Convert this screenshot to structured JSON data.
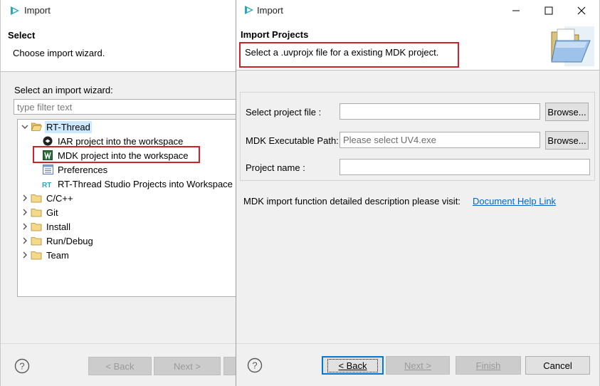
{
  "left_dialog": {
    "title": "Import",
    "header": {
      "title": "Select",
      "description": "Choose import wizard."
    },
    "wizard_label": "Select an import wizard:",
    "filter": {
      "placeholder": "type filter text",
      "value": ""
    },
    "tree": [
      {
        "label": "RT-Thread",
        "icon": "folder-open-icon",
        "expanded": true
      },
      {
        "label": "IAR project into the workspace",
        "icon": "iar-icon"
      },
      {
        "label": "MDK project into the workspace",
        "icon": "mdk-icon",
        "highlighted": true
      },
      {
        "label": "Preferences",
        "icon": "preferences-icon"
      },
      {
        "label": "RT-Thread Studio Projects into Workspace",
        "icon": "rt-thread-icon"
      },
      {
        "label": "C/C++",
        "icon": "folder-icon"
      },
      {
        "label": "Git",
        "icon": "folder-icon"
      },
      {
        "label": "Install",
        "icon": "folder-icon"
      },
      {
        "label": "Run/Debug",
        "icon": "folder-icon"
      },
      {
        "label": "Team",
        "icon": "folder-icon"
      }
    ],
    "buttons": {
      "back": "< Back",
      "next": "Next >"
    }
  },
  "right_dialog": {
    "title": "Import",
    "header": {
      "title": "Import Projects",
      "description": "Select a .uvprojx file for a existing MDK project."
    },
    "form": {
      "project_file": {
        "label": "Select project file :",
        "value": "",
        "browse": "Browse..."
      },
      "mdk_path": {
        "label": "MDK Executable Path:",
        "placeholder": "Please select UV4.exe",
        "value": "",
        "browse": "Browse..."
      },
      "project_name": {
        "label": "Project name :",
        "value": ""
      }
    },
    "description": "MDK import function detailed description please visit:",
    "help_link": "Document Help Link",
    "buttons": {
      "back": "< Back",
      "next": "Next >",
      "finish": "Finish",
      "cancel": "Cancel"
    }
  },
  "colors": {
    "highlight_box": "#d0202a",
    "link": "#0066cc",
    "panel_bg": "#f0f0f0",
    "focus": "#0078d7"
  }
}
